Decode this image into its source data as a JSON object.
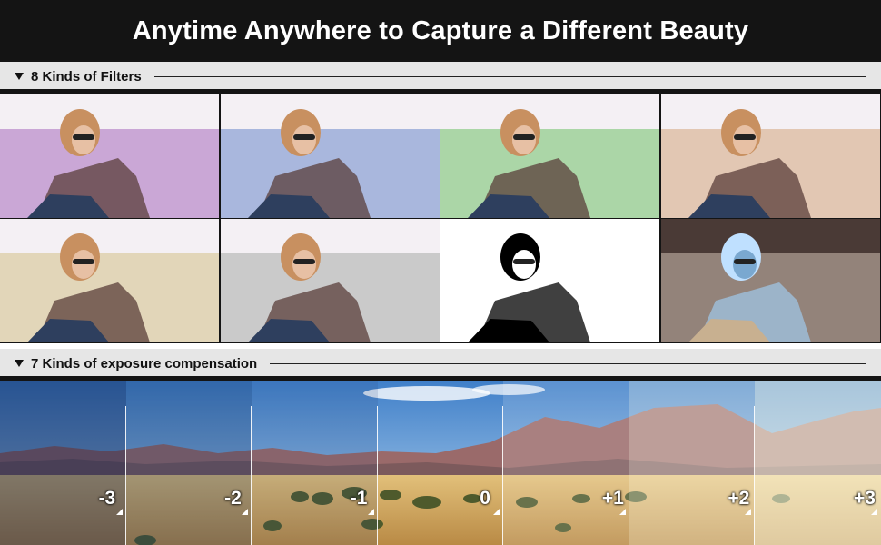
{
  "banner": {
    "title": "Anytime Anywhere to Capture a Different Beauty"
  },
  "filters_section": {
    "label": "8 Kinds of Filters",
    "tiles": [
      {
        "name": "purple-filter",
        "tint": "#b88ac8"
      },
      {
        "name": "blue-filter",
        "tint": "#8c9fd2"
      },
      {
        "name": "green-filter",
        "tint": "#8fc98a"
      },
      {
        "name": "warm-filter",
        "tint": "#d9b49a"
      },
      {
        "name": "natural-filter",
        "tint": "#d8c9a2"
      },
      {
        "name": "grayscale-filter",
        "tint": "#b8b8b8"
      },
      {
        "name": "black-white-filter",
        "tint": "#ffffff"
      },
      {
        "name": "negative-filter",
        "tint": "#6b8fb0"
      }
    ]
  },
  "exposure_section": {
    "label": "7 Kinds of exposure compensation",
    "levels": [
      {
        "label": "-3",
        "overlay": "rgba(10,30,80,0.45)"
      },
      {
        "label": "-2",
        "overlay": "rgba(20,50,100,0.30)"
      },
      {
        "label": "-1",
        "overlay": "rgba(40,70,120,0.15)"
      },
      {
        "label": "0",
        "overlay": "rgba(255,255,255,0.0)"
      },
      {
        "label": "+1",
        "overlay": "rgba(255,255,255,0.15)"
      },
      {
        "label": "+2",
        "overlay": "rgba(255,255,240,0.35)"
      },
      {
        "label": "+3",
        "overlay": "rgba(255,255,235,0.55)"
      }
    ]
  },
  "colors": {
    "banner_bg": "#141414",
    "header_bg": "#e6e6e6"
  }
}
